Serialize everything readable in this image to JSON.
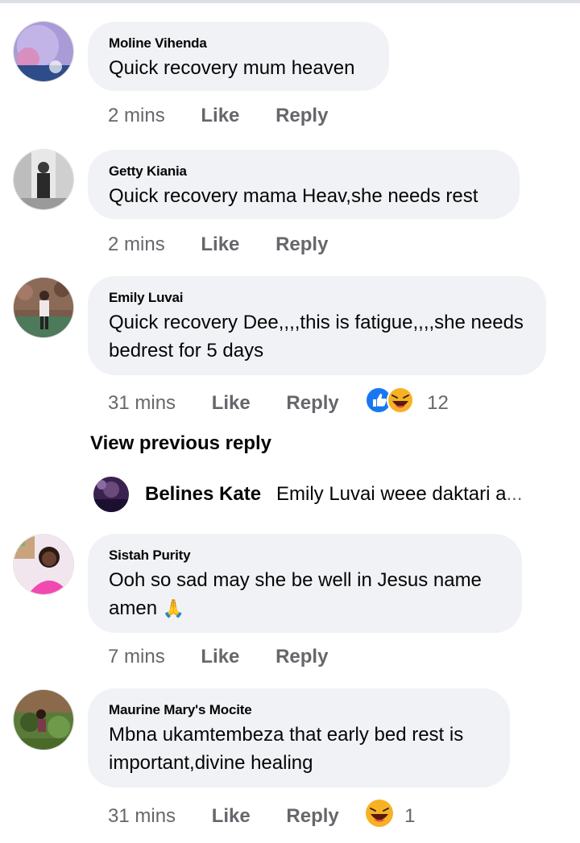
{
  "comments": [
    {
      "author": "Moline Vihenda",
      "text": "Quick recovery mum heaven",
      "time": "2 mins",
      "like": "Like",
      "reply": "Reply"
    },
    {
      "author": "Getty Kiania",
      "text": "Quick recovery mama Heav,she needs rest",
      "time": "2 mins",
      "like": "Like",
      "reply": "Reply"
    },
    {
      "author": "Emily Luvai",
      "text_line1": "Quick recovery Dee,,,,this is fatigue,,,,she needs",
      "text_line2": "bedrest for 5 days",
      "time": "31 mins",
      "like": "Like",
      "reply": "Reply",
      "reaction_count": "12",
      "reactions": [
        "like-reaction-icon",
        "haha-reaction-icon"
      ]
    },
    {
      "author": "Sistah Purity",
      "text_line1": "Ooh so sad may she be well in Jesus name",
      "text_line2": "amen",
      "emoji": "🙏",
      "time": "7 mins",
      "like": "Like",
      "reply": "Reply"
    },
    {
      "author": "Maurine Mary's Mocite",
      "text_line1": "Mbna ukamtembeza that early bed rest is",
      "text_line2": "important,divine healing",
      "time": "31 mins",
      "like": "Like",
      "reply": "Reply",
      "reaction_count": "1",
      "reactions": [
        "haha-reaction-icon"
      ]
    }
  ],
  "view_previous": "View previous reply",
  "sub_reply": {
    "author": "Belines Kate",
    "text": "Emily Luvai weee daktari a",
    "ellipsis": "..."
  },
  "colors": {
    "bubble": "#f0f2f5",
    "secondary_text": "#65676b",
    "like_blue": "#1877f2",
    "haha_yellow": "#f7b125"
  }
}
